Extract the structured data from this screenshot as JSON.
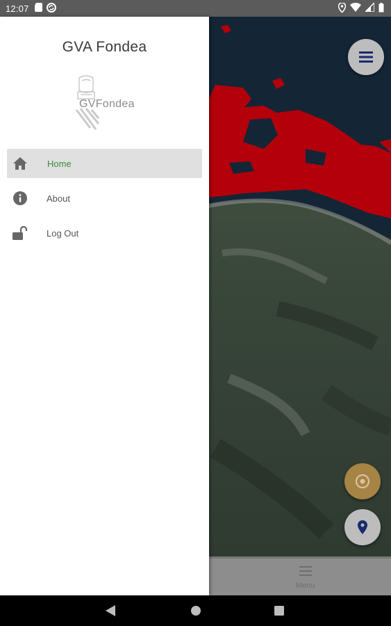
{
  "status_bar": {
    "time": "12:07",
    "left_icons": [
      "sd-card-icon",
      "sync-icon"
    ],
    "right_icons": [
      "location-icon",
      "wifi-icon",
      "signal-icon",
      "battery-icon"
    ]
  },
  "drawer": {
    "title": "GVA Fondea",
    "logo_text": "GVFondea",
    "items": [
      {
        "label": "Home",
        "icon": "home-icon",
        "active": true
      },
      {
        "label": "About",
        "icon": "info-icon",
        "active": false
      },
      {
        "label": "Log Out",
        "icon": "unlock-icon",
        "active": false
      }
    ]
  },
  "bottom_bar": {
    "menu_label": "Menu"
  },
  "colors": {
    "active_label": "#3b8a3b",
    "active_bg": "#e0e0e0",
    "overlay_red": "#b3000b",
    "sea": "#142536",
    "locate_button": "#a58445",
    "pin_icon": "#1a2a6c"
  }
}
